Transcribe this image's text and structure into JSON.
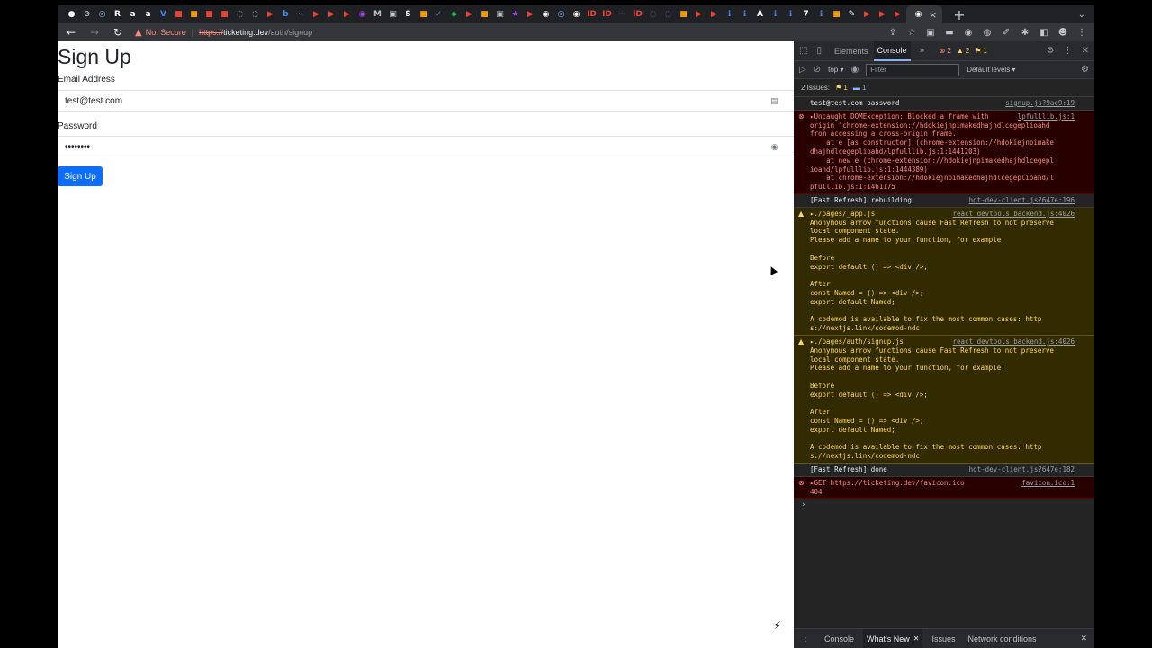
{
  "browser": {
    "tab_close_label": "×",
    "new_tab_label": "+",
    "tab_overflow_label": "⌄",
    "back_label": "←",
    "forward_label": "→",
    "reload_label": "↻",
    "not_secure_label": "Not Secure",
    "url_scheme": "https://",
    "url_host": "ticketing.dev",
    "url_path": "/auth/signup",
    "favicons": [
      {
        "glyph": "●",
        "color": "#ffffff"
      },
      {
        "glyph": "⊘",
        "color": "#bdc1c6"
      },
      {
        "glyph": "◎",
        "color": "#8ab4f8"
      },
      {
        "glyph": "R",
        "color": "#ffffff"
      },
      {
        "glyph": "a",
        "color": "#ffffff"
      },
      {
        "glyph": "a",
        "color": "#ffffff"
      },
      {
        "glyph": "V",
        "color": "#4285f4"
      },
      {
        "glyph": "■",
        "color": "#ea4335"
      },
      {
        "glyph": "■",
        "color": "#f29900"
      },
      {
        "glyph": "■",
        "color": "#ea4335"
      },
      {
        "glyph": "■",
        "color": "#ea4335"
      },
      {
        "glyph": "◌",
        "color": "#8ab4f8"
      },
      {
        "glyph": "◌",
        "color": "#8ab4f8"
      },
      {
        "glyph": "▶",
        "color": "#ea4335"
      },
      {
        "glyph": "b",
        "color": "#4285f4"
      },
      {
        "glyph": "⌁",
        "color": "#8ab4f8"
      },
      {
        "glyph": "▶",
        "color": "#ea4335"
      },
      {
        "glyph": "▶",
        "color": "#ea4335"
      },
      {
        "glyph": "▶",
        "color": "#ea4335"
      },
      {
        "glyph": "◉",
        "color": "#a142f4"
      },
      {
        "glyph": "M",
        "color": "#bdc1c6"
      },
      {
        "glyph": "▣",
        "color": "#bdc1c6"
      },
      {
        "glyph": "S",
        "color": "#ffffff"
      },
      {
        "glyph": "■",
        "color": "#f29900"
      },
      {
        "glyph": "✓",
        "color": "#4285f4"
      },
      {
        "glyph": "◆",
        "color": "#34a853"
      },
      {
        "glyph": "▶",
        "color": "#ea4335"
      },
      {
        "glyph": "■",
        "color": "#f29900"
      },
      {
        "glyph": "▣",
        "color": "#bdc1c6"
      },
      {
        "glyph": "★",
        "color": "#a142f4"
      },
      {
        "glyph": "▶",
        "color": "#ea4335"
      },
      {
        "glyph": "◉",
        "color": "#ffffff"
      },
      {
        "glyph": "◎",
        "color": "#8ab4f8"
      },
      {
        "glyph": "◉",
        "color": "#ffffff"
      },
      {
        "glyph": "ID",
        "color": "#ea4335"
      },
      {
        "glyph": "ID",
        "color": "#ea4335"
      },
      {
        "glyph": "—",
        "color": "#bdc1c6"
      },
      {
        "glyph": "ID",
        "color": "#ea4335"
      },
      {
        "glyph": "◌",
        "color": "#5f6368"
      },
      {
        "glyph": "◌",
        "color": "#a142f4"
      },
      {
        "glyph": "■",
        "color": "#f29900"
      },
      {
        "glyph": "▶",
        "color": "#ea4335"
      },
      {
        "glyph": "▶",
        "color": "#ea4335"
      },
      {
        "glyph": "ℹ",
        "color": "#4285f4"
      },
      {
        "glyph": "ℹ",
        "color": "#4285f4"
      },
      {
        "glyph": "A",
        "color": "#ffffff"
      },
      {
        "glyph": "ℹ",
        "color": "#4285f4"
      },
      {
        "glyph": "ℹ",
        "color": "#4285f4"
      },
      {
        "glyph": "7",
        "color": "#ffffff"
      },
      {
        "glyph": "ℹ",
        "color": "#4285f4"
      },
      {
        "glyph": "■",
        "color": "#f29900"
      },
      {
        "glyph": "✎",
        "color": "#ffffff"
      },
      {
        "glyph": "▶",
        "color": "#ea4335"
      },
      {
        "glyph": "▶",
        "color": "#ea4335"
      },
      {
        "glyph": "▶",
        "color": "#ea4335"
      }
    ],
    "toolbar_icons": [
      {
        "name": "share-icon",
        "glyph": "⇪"
      },
      {
        "name": "bookmark-star-icon",
        "glyph": "☆"
      },
      {
        "name": "extension-red-icon",
        "glyph": "▣"
      },
      {
        "name": "extension-lastpass-icon",
        "glyph": "▬"
      },
      {
        "name": "extension-circle-icon",
        "glyph": "◉"
      },
      {
        "name": "extension-grey-icon",
        "glyph": "◍"
      },
      {
        "name": "extension-pen-icon",
        "glyph": "✐"
      },
      {
        "name": "extensions-puzzle-icon",
        "glyph": "✱"
      },
      {
        "name": "sidebar-icon",
        "glyph": "◧"
      },
      {
        "name": "profile-icon",
        "glyph": "☻"
      },
      {
        "name": "menu-kebab-icon",
        "glyph": "⋮"
      }
    ]
  },
  "page": {
    "title": "Sign Up",
    "email_label": "Email Address",
    "email_value": "test@test.com",
    "password_label": "Password",
    "password_value": "••••••••",
    "submit_label": "Sign Up",
    "email_icon": "▤",
    "password_icon": "◉",
    "nextjs_indicator": "⚡",
    "cursor_glyph": "▲"
  },
  "devtools": {
    "tabs": [
      {
        "label": "Elements",
        "active": false
      },
      {
        "label": "Console",
        "active": true
      }
    ],
    "more_tabs_label": "»",
    "counts": {
      "errors": "2",
      "warnings": "2",
      "issues": "1"
    },
    "context": "top ▾",
    "filter_placeholder": "Filter",
    "levels": "Default levels ▾",
    "issues_bar": {
      "label": "2 Issues:",
      "warn_count": "1",
      "info_count": "1"
    },
    "messages": [
      {
        "level": "log",
        "text": "test@test.com password",
        "source": "signup.js?9ac9:19"
      },
      {
        "level": "error",
        "lines": [
          "▸Uncaught DOMException: Blocked a frame with",
          "origin \"chrome-extension://hdokiejnpimakedhajhdlcegeplioahd",
          "from accessing a cross-origin frame.",
          "    at e [as constructor] (chrome-extension://hdokiejnpimake",
          "dhajhdlcegeplioahd/lpfulllib.js:1:1441203)",
          "    at new e (chrome-extension://hdokiejnpimakedhajhdlcegepl",
          "ioahd/lpfulllib.js:1:1444389)",
          "    at chrome-extension://hdokiejnpimakedhajhdlcegeplioahd/l",
          "pfulllib.js:1:1461175"
        ],
        "source": "lpfulllib.js:1"
      },
      {
        "level": "log",
        "text": "[Fast Refresh] rebuilding",
        "source": "hot-dev-client.js?647e:196"
      },
      {
        "level": "warn",
        "lines": [
          "▸./pages/_app.js",
          "Anonymous arrow functions cause Fast Refresh to not preserve",
          "local component state.",
          "Please add a name to your function, for example:",
          "",
          "Before",
          "export default () => <div />;",
          "",
          "After",
          "const Named = () => <div />;",
          "export default Named;",
          "",
          "A codemod is available to fix the most common cases: http",
          "s://nextjs.link/codemod-ndc"
        ],
        "source": "react_devtools_backend.js:4026"
      },
      {
        "level": "warn",
        "lines": [
          "▸./pages/auth/signup.js",
          "Anonymous arrow functions cause Fast Refresh to not preserve",
          "local component state.",
          "Please add a name to your function, for example:",
          "",
          "Before",
          "export default () => <div />;",
          "",
          "After",
          "const Named = () => <div />;",
          "export default Named;",
          "",
          "A codemod is available to fix the most common cases: http",
          "s://nextjs.link/codemod-ndc"
        ],
        "source": "react_devtools_backend.js:4026"
      },
      {
        "level": "log",
        "text": "[Fast Refresh] done",
        "source": "hot-dev-client.js?647e:182"
      },
      {
        "level": "error",
        "lines": [
          "▸GET https://ticketing.dev/favicon.ico",
          "404"
        ],
        "source": "favicon.ico:1"
      }
    ],
    "prompt": "›",
    "drawer": {
      "tabs": [
        {
          "label": "Console",
          "active": false
        },
        {
          "label": "What's New",
          "active": true,
          "closable": true
        },
        {
          "label": "Issues",
          "active": false
        },
        {
          "label": "Network conditions",
          "active": false
        }
      ],
      "close_label": "✕",
      "menu_label": "⋮"
    }
  }
}
